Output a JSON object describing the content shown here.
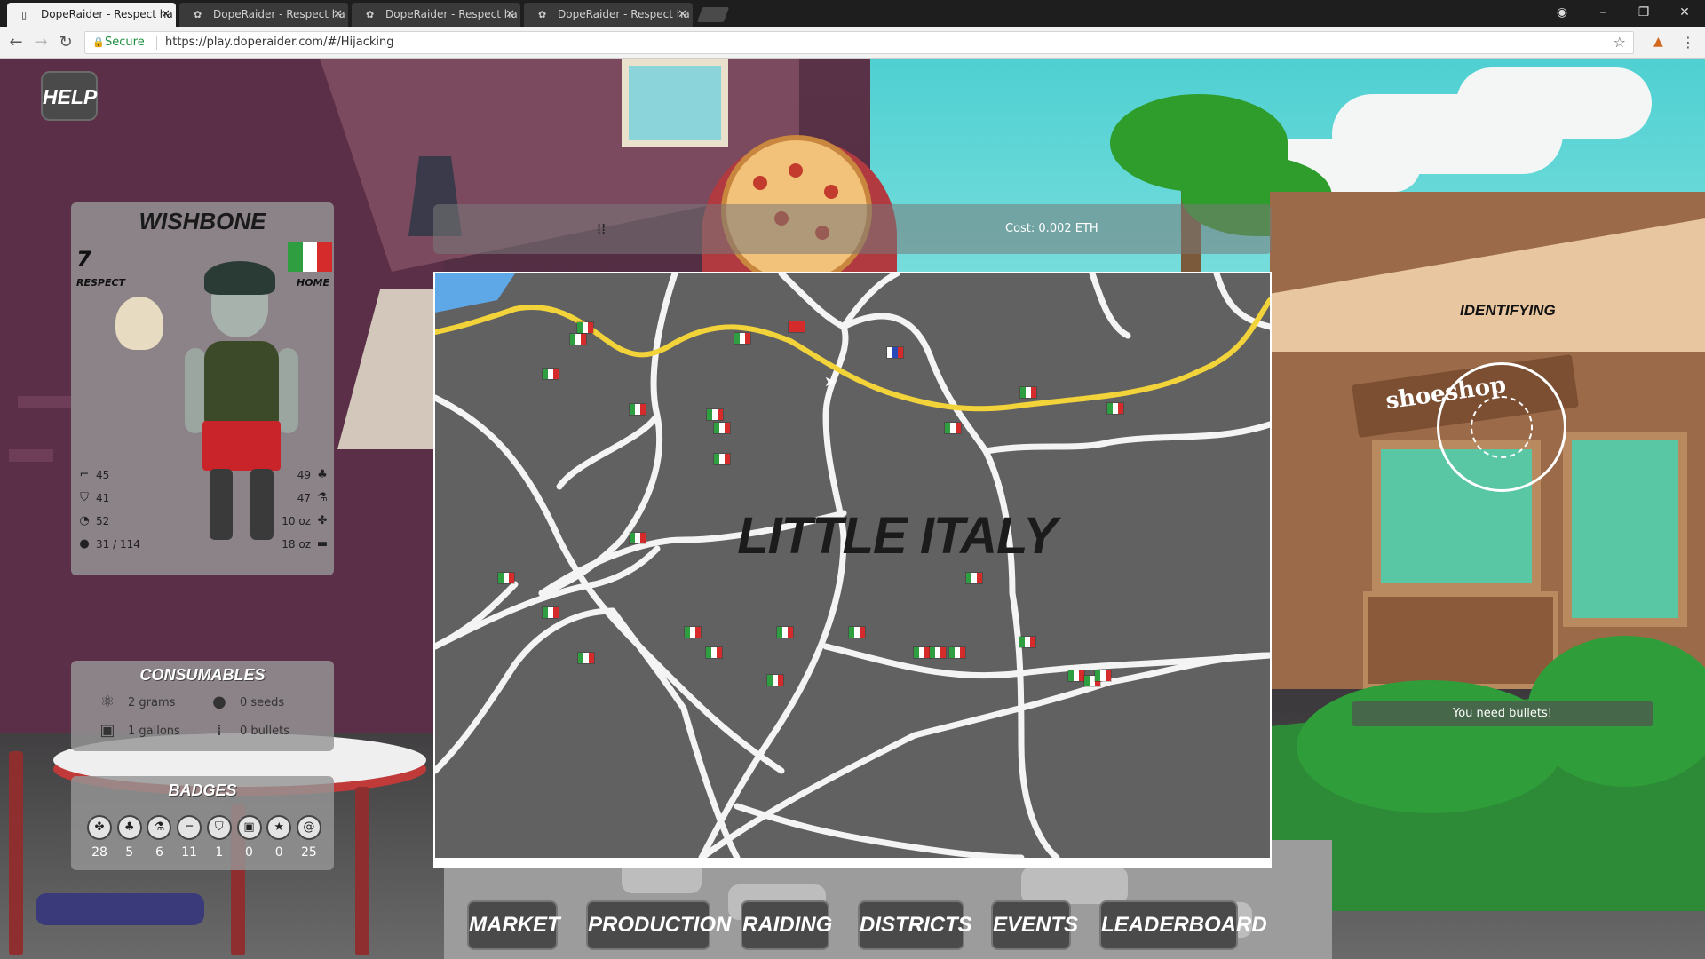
{
  "browser": {
    "tabs": [
      {
        "label": "DopeRaider - Respect ha",
        "active": true
      },
      {
        "label": "DopeRaider - Respect ha",
        "active": false
      },
      {
        "label": "DopeRaider - Respect ha",
        "active": false
      },
      {
        "label": "DopeRaider - Respect ha",
        "active": false
      }
    ],
    "secure_label": "Secure",
    "url": "https://play.doperaider.com/#/Hijacking"
  },
  "hud": {
    "help_label": "HELP",
    "character": {
      "name": "WISHBONE",
      "respect_value": "7",
      "respect_label": "RESPECT",
      "home_label": "HOME",
      "home_flag_colors": [
        "#2f9e41",
        "#ffffff",
        "#d52b2b"
      ],
      "stats_left": [
        {
          "icon": "gun-icon",
          "value": "45"
        },
        {
          "icon": "shield-icon",
          "value": "41"
        },
        {
          "icon": "speed-icon",
          "value": "52"
        },
        {
          "icon": "bag-icon",
          "value": "31 / 114"
        }
      ],
      "stats_right": [
        {
          "icon": "plant-icon",
          "value": "49"
        },
        {
          "icon": "flask-icon",
          "value": "47"
        },
        {
          "icon": "leaf-icon",
          "value": "10 oz"
        },
        {
          "icon": "brick-icon",
          "value": "18 oz"
        }
      ]
    },
    "consumables": {
      "title": "CONSUMABLES",
      "items": [
        {
          "icon": "atom-icon",
          "label": "2 grams"
        },
        {
          "icon": "seed-icon",
          "label": "0 seeds"
        },
        {
          "icon": "jerrycan-icon",
          "label": "1 gallons"
        },
        {
          "icon": "bullets-icon",
          "label": "0 bullets"
        }
      ]
    },
    "badges": {
      "title": "BADGES",
      "items": [
        {
          "icon": "weed-badge-icon",
          "value": "28"
        },
        {
          "icon": "plant-badge-icon",
          "value": "5"
        },
        {
          "icon": "flask-badge-icon",
          "value": "6"
        },
        {
          "icon": "gun-badge-icon",
          "value": "11"
        },
        {
          "icon": "shield-badge-icon",
          "value": "1"
        },
        {
          "icon": "box-badge-icon",
          "value": "0"
        },
        {
          "icon": "runner-badge-icon",
          "value": "0"
        },
        {
          "icon": "spiral-badge-icon",
          "value": "25"
        }
      ]
    }
  },
  "infobar": {
    "link_label": "",
    "cost_label": "Cost: 0.002 ETH"
  },
  "map": {
    "district_name": "LITTLE ITALY",
    "flag_colors": {
      "italy": [
        "#2f9e41",
        "#ffffff",
        "#d52b2b"
      ],
      "russia": [
        "#ffffff",
        "#2a49b8",
        "#d52b2b"
      ],
      "china": [
        "#d52b2b",
        "#d52b2b",
        "#d52b2b"
      ]
    }
  },
  "scene": {
    "shop_sign": "shoeshop",
    "identifying_label": "IDENTIFYING",
    "need_message": "You need bullets!"
  },
  "nav": [
    {
      "key": "market",
      "label": "MARKET"
    },
    {
      "key": "production",
      "label": "PRODUCTION"
    },
    {
      "key": "raiding",
      "label": "RAIDING"
    },
    {
      "key": "districts",
      "label": "DISTRICTS"
    },
    {
      "key": "events",
      "label": "EVENTS"
    },
    {
      "key": "leaderboard",
      "label": "LEADERBOARD"
    }
  ]
}
